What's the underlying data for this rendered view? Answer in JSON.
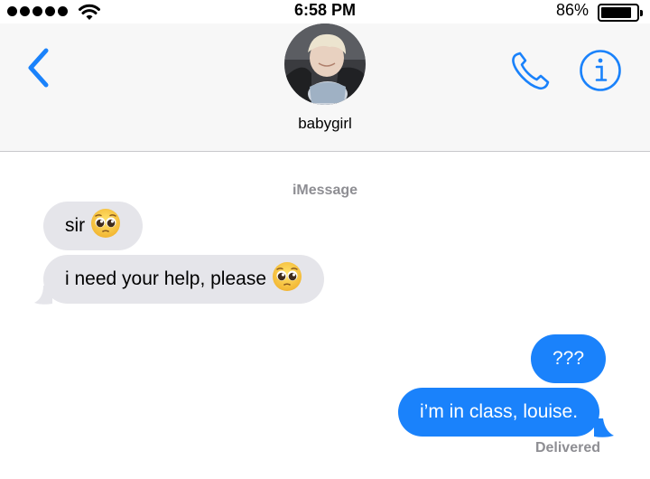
{
  "status_bar": {
    "time": "6:58 PM",
    "battery_percent": "86%",
    "battery_level": 0.86,
    "signal_bars": 5
  },
  "header": {
    "contact_name": "babygirl",
    "icons": [
      "back-chevron-icon",
      "phone-icon",
      "info-icon"
    ]
  },
  "conversation": {
    "service_label": "iMessage",
    "messages": [
      {
        "direction": "incoming",
        "text": "sir",
        "emoji": "pleading-face"
      },
      {
        "direction": "incoming",
        "text": "i need your help, please",
        "emoji": "pleading-face"
      },
      {
        "direction": "outgoing",
        "text": "???"
      },
      {
        "direction": "outgoing",
        "text": "i’m in class, louise."
      }
    ],
    "delivery_status": "Delivered"
  },
  "colors": {
    "accent": "#1a82fb",
    "incoming_bubble": "#e5e5ea",
    "header_bg": "#f7f7f7",
    "secondary_text": "#8e8e93"
  }
}
